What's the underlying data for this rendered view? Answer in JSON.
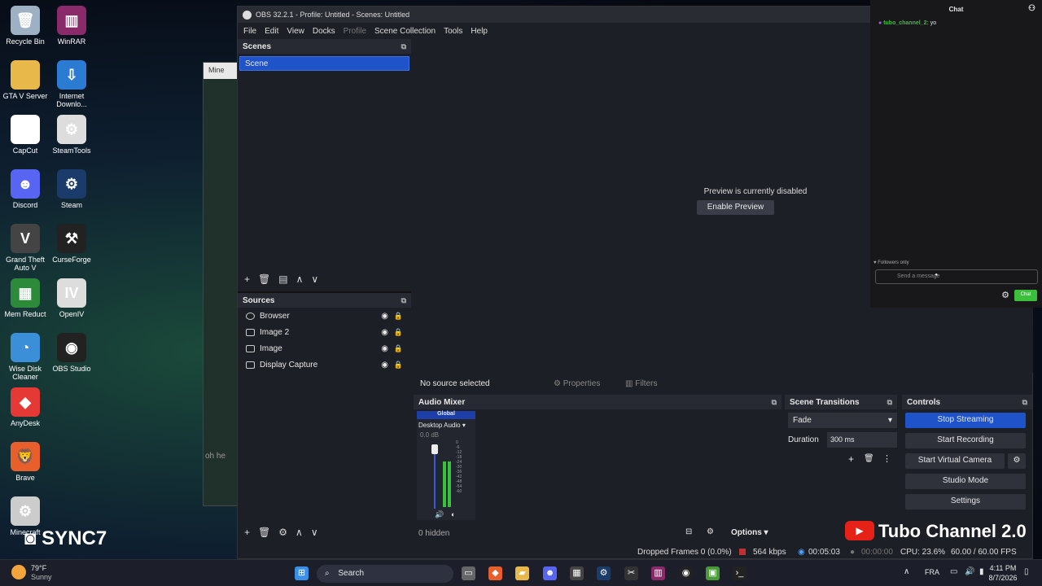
{
  "desktop_icons": [
    {
      "label": "Recycle Bin",
      "icon": "recycle-bin-icon",
      "color": "#9db0c4",
      "glyph": "🗑"
    },
    {
      "label": "WinRAR",
      "icon": "winrar-icon",
      "color": "#8b2a6b",
      "glyph": "▥"
    },
    {
      "label": "GTA V Server",
      "icon": "folder-icon",
      "color": "#e8b84a",
      "glyph": ""
    },
    {
      "label": "Internet Downlo...",
      "icon": "idm-icon",
      "color": "#2a7bd1",
      "glyph": "⇩"
    },
    {
      "label": "CapCut",
      "icon": "capcut-icon",
      "color": "#ffffff",
      "glyph": "✂"
    },
    {
      "label": "SteamTools",
      "icon": "steamtools-icon",
      "color": "#ddd",
      "glyph": "⚙"
    },
    {
      "label": "Discord",
      "icon": "discord-icon",
      "color": "#5865f2",
      "glyph": "☻"
    },
    {
      "label": "Steam",
      "icon": "steam-icon",
      "color": "#1b3b6b",
      "glyph": "⚙"
    },
    {
      "label": "Grand Theft Auto V",
      "icon": "gta-icon",
      "color": "#444",
      "glyph": "V"
    },
    {
      "label": "CurseForge",
      "icon": "curseforge-icon",
      "color": "#222",
      "glyph": "⚒"
    },
    {
      "label": "Mem Reduct",
      "icon": "memreduct-icon",
      "color": "#2d8a3a",
      "glyph": "▦"
    },
    {
      "label": "OpenIV",
      "icon": "openiv-icon",
      "color": "#ddd",
      "glyph": "IV"
    },
    {
      "label": "Wise Disk Cleaner",
      "icon": "wisedisk-icon",
      "color": "#3b8fd8",
      "glyph": "◔"
    },
    {
      "label": "OBS Studio",
      "icon": "obs-icon",
      "color": "#222",
      "glyph": "◉"
    },
    {
      "label": "AnyDesk",
      "icon": "anydesk-icon",
      "color": "#e53935",
      "glyph": "◆"
    },
    {
      "label": "Brave",
      "icon": "brave-icon",
      "color": "#e85f2b",
      "glyph": "🦁"
    },
    {
      "label": "Minecraft",
      "icon": "minecraft-icon",
      "color": "#ccc",
      "glyph": "⚙"
    }
  ],
  "ghost_window_title": "Mine",
  "ghost_window_text": "oh he",
  "watermark_left": "SYNC7",
  "watermark_right": "Tubo Channel 2.0",
  "obs": {
    "title": "OBS 32.2.1 - Profile: Untitled - Scenes: Untitled",
    "menu": [
      "File",
      "Edit",
      "View",
      "Docks",
      "Profile",
      "Scene Collection",
      "Tools",
      "Help"
    ],
    "scenes_header": "Scenes",
    "scenes": [
      "Scene"
    ],
    "sources_header": "Sources",
    "sources": [
      "Browser",
      "Image 2",
      "Image",
      "Display Capture"
    ],
    "preview_disabled": "Preview is currently disabled",
    "enable_preview": "Enable Preview",
    "no_source": "No source selected",
    "properties": "Properties",
    "filters": "Filters",
    "audio_mixer_header": "Audio Mixer",
    "mixer_global": "Global",
    "mixer_channel": "Desktop Audio",
    "mixer_db": "0.0 dB",
    "mixer_ticks": [
      "0",
      "-6",
      "-12",
      "-18",
      "-24",
      "-30",
      "-36",
      "-42",
      "-48",
      "-54",
      "-60"
    ],
    "hidden_label": "0 hidden",
    "options": "Options",
    "transitions_header": "Scene Transitions",
    "transition_type": "Fade",
    "duration_label": "Duration",
    "duration_value": "300 ms",
    "controls_header": "Controls",
    "controls": {
      "stop_streaming": "Stop Streaming",
      "start_recording": "Start Recording",
      "start_virtual_camera": "Start Virtual Camera",
      "studio_mode": "Studio Mode",
      "settings": "Settings"
    },
    "status": {
      "dropped": "Dropped Frames 0 (0.0%)",
      "kbps": "564 kbps",
      "stream_time": "00:05:03",
      "rec_time": "00:00:00",
      "cpu": "CPU: 23.6%",
      "fps": "60.00 / 60.00 FPS"
    }
  },
  "chat": {
    "header": "Chat",
    "username": "tubo_channel_2:",
    "message": "yo",
    "followers_only": "Followers only",
    "placeholder": "Send a message",
    "send": "Chat"
  },
  "taskbar": {
    "weather_temp": "79°F",
    "weather_desc": "Sunny",
    "search": "Search",
    "lang": "FRA",
    "time": "4:11 PM",
    "date": "8/7/2026"
  }
}
